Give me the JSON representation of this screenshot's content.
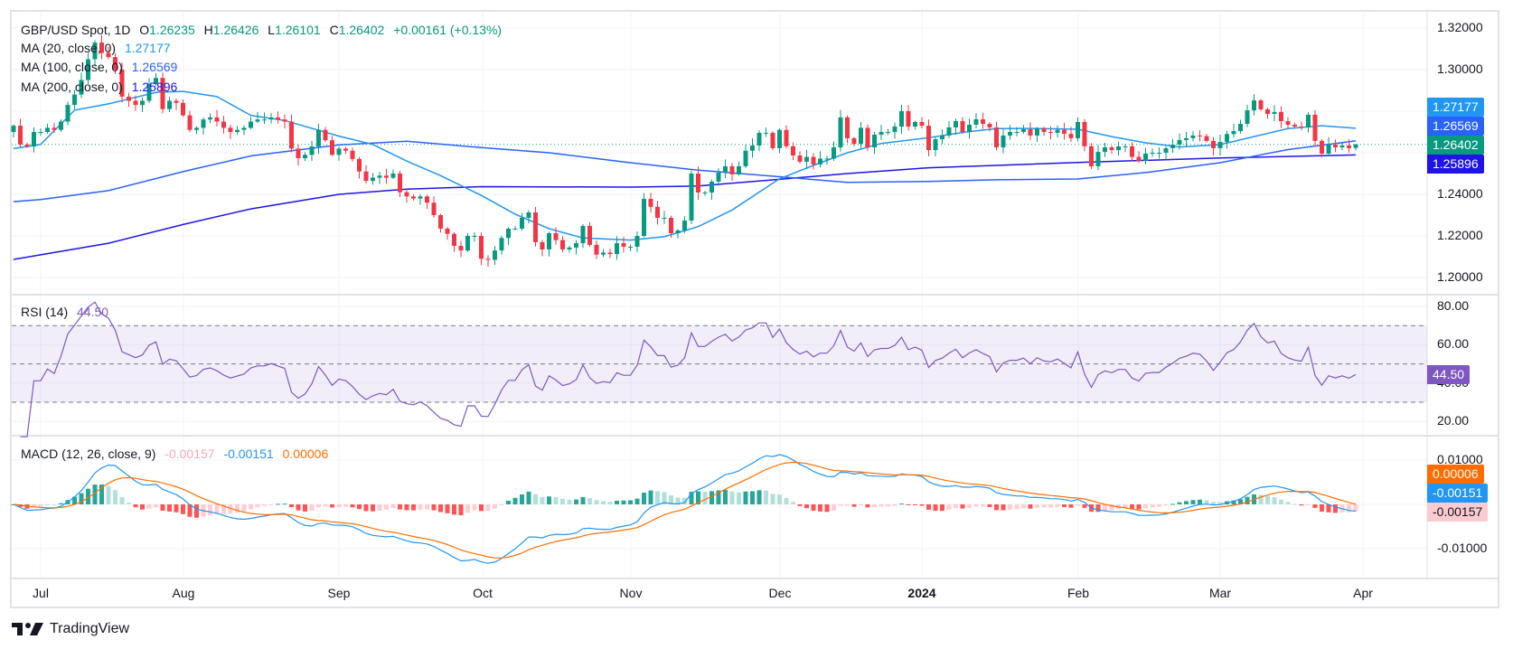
{
  "header": {
    "symbol": "GBP/USD Spot, 1D",
    "o_label": "O",
    "o": "1.26235",
    "h_label": "H",
    "h": "1.26426",
    "l_label": "L",
    "l": "1.26101",
    "c_label": "C",
    "c": "1.26402",
    "change": "+0.00161 (+0.13%)"
  },
  "indicators": {
    "ma20": {
      "label": "MA (20, close, 0)",
      "value": "1.27177",
      "color": "#2196f3"
    },
    "ma100": {
      "label": "MA (100, close, 0)",
      "value": "1.26569",
      "color": "#2962ff"
    },
    "ma200": {
      "label": "MA (200, close, 0)",
      "value": "1.25896",
      "color": "#1e14e8"
    }
  },
  "rsi": {
    "label": "RSI (14)",
    "value": "44.50",
    "color": "#7e57c2"
  },
  "macd": {
    "label": "MACD (12, 26, close, 9)",
    "hist": "-0.00157",
    "macd": "-0.00151",
    "signal": "0.00006",
    "macd_color": "#2196f3",
    "signal_color": "#ff6d00",
    "hist_color": "#f7a9b3"
  },
  "price_tags": {
    "ma20": "1.27177",
    "ma100": "1.26569",
    "last": "1.26402",
    "ma200": "1.25896"
  },
  "rsi_tag": "44.50",
  "macd_tags": {
    "signal": "0.00006",
    "macd": "-0.00151",
    "hist": "-0.00157"
  },
  "price_axis": [
    "1.32000",
    "1.30000",
    "1.24000",
    "1.22000",
    "1.20000"
  ],
  "rsi_axis": [
    "80.00",
    "60.00",
    "40.00",
    "20.00"
  ],
  "macd_axis": [
    "0.01000",
    "-0.01000"
  ],
  "time_axis": [
    "Jul",
    "Aug",
    "Sep",
    "Oct",
    "Nov",
    "Dec",
    "2024",
    "Feb",
    "Mar",
    "Apr"
  ],
  "brand": "TradingView",
  "colors": {
    "up": "#089981",
    "down": "#f23645",
    "rsi_band": "#7e57c2"
  },
  "chart_data": {
    "type": "candlestick",
    "title": "GBP/USD Spot, 1D",
    "ylim": [
      1.2,
      1.32
    ],
    "grid": true,
    "closes": [
      1.273,
      1.264,
      1.263,
      1.27,
      1.27,
      1.272,
      1.271,
      1.275,
      1.283,
      1.288,
      1.295,
      1.305,
      1.313,
      1.308,
      1.306,
      1.3,
      1.287,
      1.285,
      1.283,
      1.285,
      1.293,
      1.296,
      1.281,
      1.285,
      1.284,
      1.278,
      1.271,
      1.272,
      1.276,
      1.277,
      1.275,
      1.272,
      1.27,
      1.271,
      1.272,
      1.275,
      1.276,
      1.276,
      1.277,
      1.276,
      1.275,
      1.262,
      1.2574,
      1.259,
      1.263,
      1.271,
      1.266,
      1.259,
      1.262,
      1.261,
      1.257,
      1.251,
      1.2465,
      1.248,
      1.249,
      1.248,
      1.25,
      1.241,
      1.239,
      1.238,
      1.239,
      1.236,
      1.23,
      1.2235,
      1.221,
      1.2152,
      1.213,
      1.22,
      1.22,
      1.209,
      1.2085,
      1.213,
      1.219,
      1.2235,
      1.2235,
      1.2287,
      1.2313,
      1.217,
      1.2135,
      1.2213,
      1.218,
      1.2135,
      1.2144,
      1.2165,
      1.2248,
      1.2157,
      1.211,
      1.212,
      1.2113,
      1.2165,
      1.2148,
      1.2148,
      1.22,
      1.2378,
      1.234,
      1.2287,
      1.2287,
      1.2213,
      1.2226,
      1.2274,
      1.25,
      1.2409,
      1.2409,
      1.2461,
      1.2504,
      1.2535,
      1.2496,
      1.2535,
      1.261,
      1.2635,
      1.2696,
      1.2696,
      1.2622,
      1.271,
      1.2631,
      1.2587,
      1.2557,
      1.258,
      1.2544,
      1.2572,
      1.2572,
      1.2626,
      1.277,
      1.267,
      1.2643,
      1.272,
      1.2626,
      1.2687,
      1.27,
      1.27,
      1.2726,
      1.28,
      1.2726,
      1.2748,
      1.273,
      1.2613,
      1.2665,
      1.2683,
      1.2722,
      1.2752,
      1.27,
      1.2735,
      1.2761,
      1.2739,
      1.2722,
      1.2626,
      1.2683,
      1.27,
      1.27,
      1.2713,
      1.2683,
      1.2717,
      1.27,
      1.2696,
      1.271,
      1.2691,
      1.267,
      1.2748,
      1.2631,
      1.2535,
      1.2604,
      1.2626,
      1.2613,
      1.2631,
      1.2631,
      1.258,
      1.2561,
      1.2596,
      1.26,
      1.26,
      1.2622,
      1.2639,
      1.2661,
      1.267,
      1.2683,
      1.268,
      1.2657,
      1.2622,
      1.2652,
      1.269,
      1.2704,
      1.2739,
      1.2804,
      1.2852,
      1.2809,
      1.2787,
      1.2796,
      1.2752,
      1.2735,
      1.2726,
      1.2722,
      1.2783,
      1.2657,
      1.2596,
      1.2639,
      1.2626,
      1.2635,
      1.2622,
      1.26402
    ],
    "last_bar": {
      "open": 1.26235,
      "high": 1.26426,
      "low": 1.26101,
      "close": 1.26402
    },
    "ma20": [
      [
        "2023-06-27",
        1.262
      ],
      [
        "2023-07-03",
        1.264
      ],
      [
        "2023-07-10",
        1.2805
      ],
      [
        "2023-07-17",
        1.2835
      ],
      [
        "2023-07-26",
        1.289
      ],
      [
        "2023-08-01",
        1.2895
      ],
      [
        "2023-08-08",
        1.287
      ],
      [
        "2023-08-15",
        1.278
      ],
      [
        "2023-08-22",
        1.2755
      ],
      [
        "2023-09-01",
        1.268
      ],
      [
        "2023-09-08",
        1.264
      ],
      [
        "2023-09-15",
        1.256
      ],
      [
        "2023-09-22",
        1.249
      ],
      [
        "2023-10-02",
        1.2395
      ],
      [
        "2023-10-09",
        1.2305
      ],
      [
        "2023-10-16",
        1.2235
      ],
      [
        "2023-10-23",
        1.219
      ],
      [
        "2023-11-01",
        1.218
      ],
      [
        "2023-11-08",
        1.2196
      ],
      [
        "2023-11-15",
        1.2245
      ],
      [
        "2023-11-22",
        1.2325
      ],
      [
        "2023-12-01",
        1.2475
      ],
      [
        "2023-12-08",
        1.2539
      ],
      [
        "2023-12-15",
        1.26
      ],
      [
        "2023-12-22",
        1.2645
      ],
      [
        "2024-01-02",
        1.2672
      ],
      [
        "2024-01-09",
        1.2698
      ],
      [
        "2024-01-16",
        1.2716
      ],
      [
        "2024-01-23",
        1.2717
      ],
      [
        "2024-02-01",
        1.2713
      ],
      [
        "2024-02-08",
        1.2678
      ],
      [
        "2024-02-15",
        1.2648
      ],
      [
        "2024-02-22",
        1.2628
      ],
      [
        "2024-03-01",
        1.2639
      ],
      [
        "2024-03-08",
        1.2678
      ],
      [
        "2024-03-15",
        1.2716
      ],
      [
        "2024-03-22",
        1.273
      ],
      [
        "2024-03-29",
        1.27177
      ]
    ],
    "ma100": [
      [
        "2023-06-27",
        1.2365
      ],
      [
        "2023-07-03",
        1.2375
      ],
      [
        "2023-07-17",
        1.2418
      ],
      [
        "2023-08-01",
        1.2509
      ],
      [
        "2023-08-15",
        1.2585
      ],
      [
        "2023-09-01",
        1.2638
      ],
      [
        "2023-09-15",
        1.2655
      ],
      [
        "2023-10-02",
        1.2625
      ],
      [
        "2023-10-16",
        1.26
      ],
      [
        "2023-11-01",
        1.2552
      ],
      [
        "2023-11-15",
        1.2516
      ],
      [
        "2023-12-01",
        1.2485
      ],
      [
        "2023-12-15",
        1.2458
      ],
      [
        "2024-01-02",
        1.2462
      ],
      [
        "2024-01-16",
        1.247
      ],
      [
        "2024-02-01",
        1.2474
      ],
      [
        "2024-02-15",
        1.2505
      ],
      [
        "2024-03-01",
        1.2552
      ],
      [
        "2024-03-15",
        1.2615
      ],
      [
        "2024-03-29",
        1.26569
      ]
    ],
    "ma200": [
      [
        "2023-06-27",
        1.2087
      ],
      [
        "2023-07-17",
        1.2165
      ],
      [
        "2023-08-01",
        1.2255
      ],
      [
        "2023-08-15",
        1.233
      ],
      [
        "2023-09-01",
        1.24
      ],
      [
        "2023-09-15",
        1.2425
      ],
      [
        "2023-10-02",
        1.2437
      ],
      [
        "2023-11-01",
        1.2435
      ],
      [
        "2023-11-15",
        1.244
      ],
      [
        "2023-12-01",
        1.2472
      ],
      [
        "2023-12-15",
        1.25
      ],
      [
        "2024-01-02",
        1.2528
      ],
      [
        "2024-02-01",
        1.2553
      ],
      [
        "2024-03-01",
        1.2575
      ],
      [
        "2024-03-29",
        1.25896
      ]
    ],
    "rsi_levels": [
      30,
      50,
      70
    ],
    "rsi_ylim": [
      10,
      85
    ],
    "macd_ylim": [
      -0.0165,
      0.0145
    ]
  }
}
